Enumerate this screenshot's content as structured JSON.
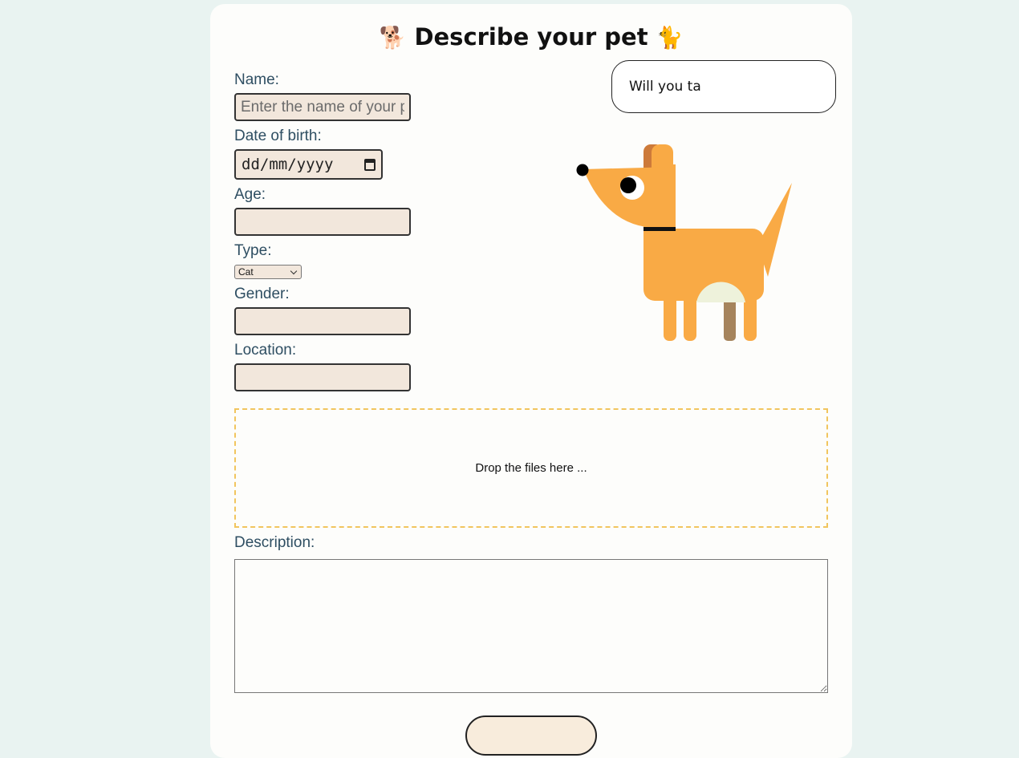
{
  "header": {
    "title": "Describe your pet",
    "emoji_left": "🐕",
    "emoji_right": "🐈"
  },
  "form": {
    "name_label": "Name:",
    "name_placeholder": "Enter the name of your pet",
    "dob_label": "Date of birth:",
    "dob_placeholder": "dd/mm/yyyy",
    "age_label": "Age:",
    "age_value": "",
    "type_label": "Type:",
    "type_selected": "Cat",
    "gender_label": "Gender:",
    "gender_value": "",
    "location_label": "Location:",
    "location_value": "",
    "dropzone_text": "Drop the files here ...",
    "description_label": "Description:",
    "description_value": "",
    "submit_label": ""
  },
  "speech_bubble": {
    "text": "Will you ta"
  },
  "icons": {
    "calendar": "calendar-icon",
    "select_chevron": "chevron-down-icon"
  },
  "colors": {
    "page_bg": "#e9f3f1",
    "card_bg": "#fdfdfb",
    "input_bg": "#f2e7dc",
    "label": "#2e4e62",
    "dog_body": "#f9aa45",
    "dropzone_border": "#f1c55e"
  }
}
